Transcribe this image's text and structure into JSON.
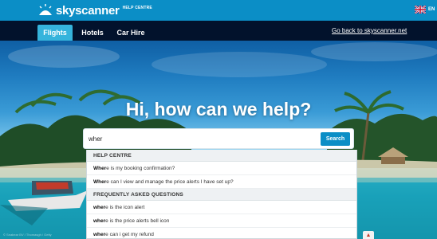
{
  "brand": {
    "name": "skyscanner",
    "sub": "HELP CENTRE",
    "language": "EN"
  },
  "nav": {
    "tabs": [
      {
        "label": "Flights",
        "active": true
      },
      {
        "label": "Hotels",
        "active": false
      },
      {
        "label": "Car Hire",
        "active": false
      }
    ],
    "back_link": "Go back to skyscanner.net"
  },
  "hero": {
    "headline": "Hi, how can we help?"
  },
  "search": {
    "value": "wher",
    "button": "Search"
  },
  "suggestions": {
    "help_centre": {
      "header": "HELP CENTRE",
      "items": [
        {
          "match": "Wher",
          "rest": "e is my booking confirmation?"
        },
        {
          "match": "Wher",
          "rest": "e can I view and manage the price alerts I have set up?"
        }
      ]
    },
    "faq": {
      "header": "FREQUENTLY ASKED QUESTIONS",
      "items": [
        {
          "match": "wher",
          "rest": "e is the icon alert"
        },
        {
          "match": "wher",
          "rest": "e is the price alerts bell icon"
        },
        {
          "match": "wher",
          "rest": "e can i get my refund"
        }
      ]
    }
  },
  "photo_credit": "© Seabear BV / Thomasgh / Getty",
  "colors": {
    "brand_blue": "#0b8ec6",
    "nav_dark": "#02122c",
    "active_tab": "#35b4dc"
  }
}
